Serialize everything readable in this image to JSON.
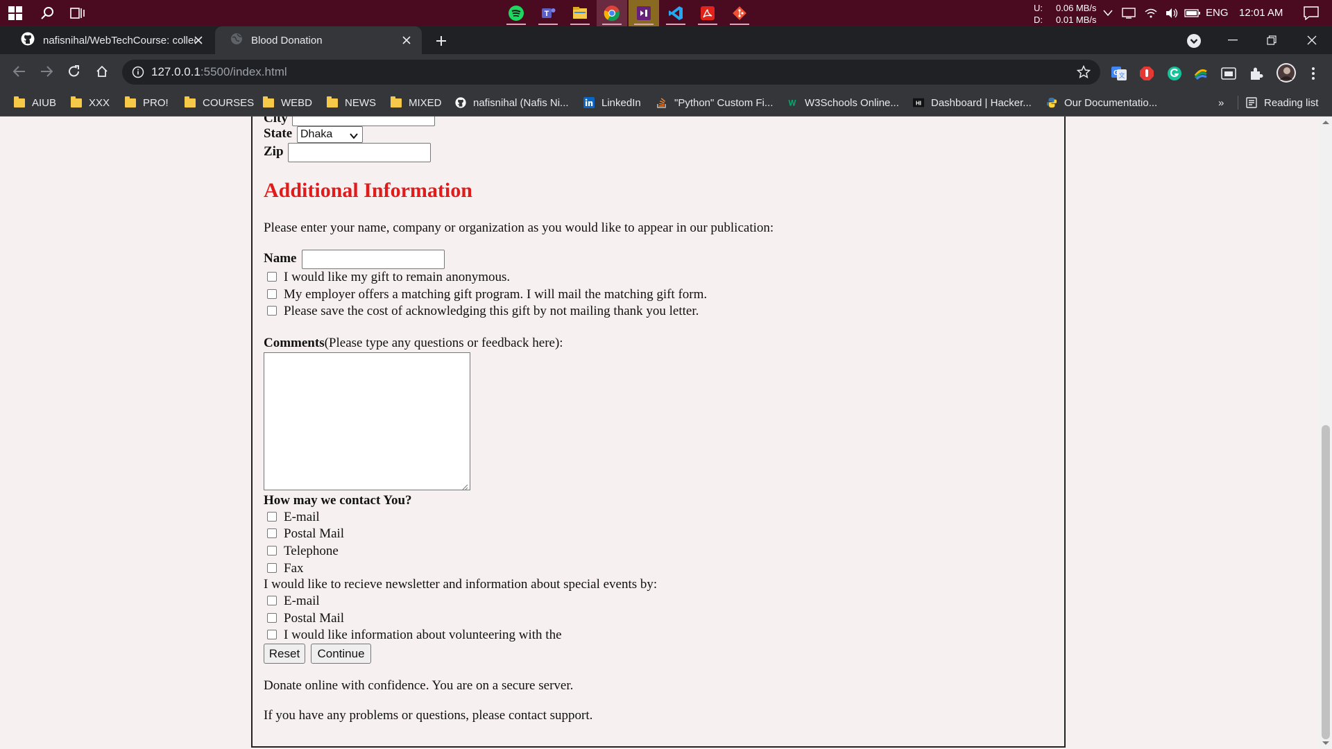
{
  "taskbar": {
    "net_up_label": "U:",
    "net_down_label": "D:",
    "net_up": "0.06 MB/s",
    "net_down": "0.01 MB/s",
    "language": "ENG",
    "time": "12:01 AM",
    "apps": [
      "spotify-icon",
      "teams-icon",
      "file-explorer-icon",
      "chrome-icon",
      "visual-studio-icon",
      "vscode-icon",
      "acrobat-icon",
      "git-icon"
    ]
  },
  "browser": {
    "tabs": [
      {
        "title": "nafisnihal/WebTechCourse: collec",
        "icon": "github-icon",
        "active": false
      },
      {
        "title": "Blood Donation",
        "icon": "globe-icon",
        "active": true
      }
    ],
    "url_host": "127.0.0.1",
    "url_rest": ":5500/index.html",
    "bookmarks": [
      {
        "label": "AIUB",
        "icon": "folder-icon"
      },
      {
        "label": "XXX",
        "icon": "folder-icon"
      },
      {
        "label": "PRO!",
        "icon": "folder-icon"
      },
      {
        "label": "COURSES",
        "icon": "folder-icon"
      },
      {
        "label": "WEBD",
        "icon": "folder-icon"
      },
      {
        "label": "NEWS",
        "icon": "folder-icon"
      },
      {
        "label": "MIXED",
        "icon": "folder-icon"
      },
      {
        "label": "nafisnihal (Nafis Ni...",
        "icon": "github-icon"
      },
      {
        "label": "LinkedIn",
        "icon": "linkedin-icon"
      },
      {
        "label": "\"Python\" Custom Fi...",
        "icon": "stackoverflow-icon"
      },
      {
        "label": "W3Schools Online...",
        "icon": "w3schools-icon"
      },
      {
        "label": "Dashboard | Hacker...",
        "icon": "hackerrank-icon"
      },
      {
        "label": "Our Documentatio...",
        "icon": "python-icon"
      }
    ],
    "more_bookmarks": "»",
    "reading_list": "Reading list"
  },
  "form": {
    "city_label": "City",
    "state_label": "State",
    "state_value": "Dhaka",
    "zip_label": "Zip",
    "additional_heading": "Additional Information",
    "publication_text": "Please enter your name, company or organization as you would like to appear in our publication:",
    "name_label": "Name",
    "gift_options": [
      "I would like my gift to remain anonymous.",
      "My employer offers a matching gift program. I will mail the matching gift form.",
      "Please save the cost of acknowledging this gift by not mailing thank you letter."
    ],
    "comments_label": "Comments",
    "comments_hint": "(Please type any questions or feedback here):",
    "contact_heading": "How may we contact You?",
    "contact_options": [
      "E-mail",
      "Postal Mail",
      "Telephone",
      "Fax"
    ],
    "newsletter_text": "I would like to recieve newsletter and information about special events by:",
    "newsletter_options": [
      "E-mail",
      "Postal Mail",
      "I would like information about volunteering with the"
    ],
    "reset_label": "Reset",
    "continue_label": "Continue",
    "secure_text": "Donate online with confidence. You are on a secure server.",
    "support_text": "If you have any problems or questions, please contact support."
  },
  "colors": {
    "taskbar_bg": "#4a0a20",
    "heading_red": "#e01b1b",
    "page_bg": "#f6f0f0"
  }
}
